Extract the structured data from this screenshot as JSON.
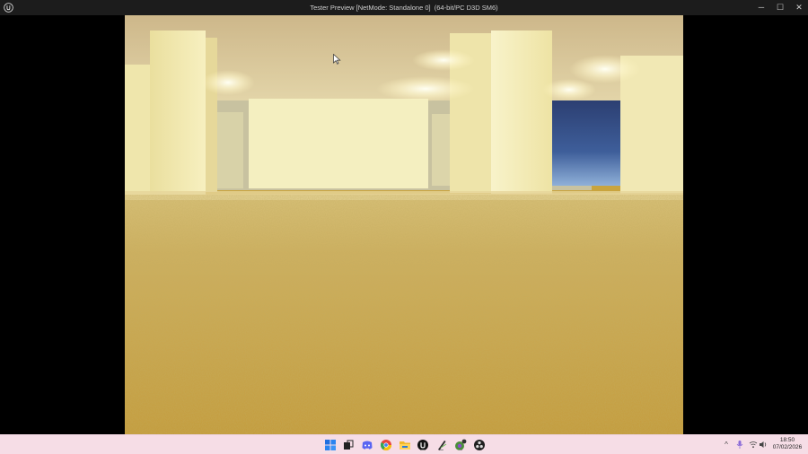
{
  "window": {
    "title": "Tester Preview [NetMode: Standalone 0]  (64-bit/PC D3D SM6)",
    "app_icon": "unreal-engine-icon",
    "controls": {
      "minimize": "─",
      "maximize": "☐",
      "close": "✕"
    }
  },
  "viewport": {
    "scene": "backrooms-style-yellow-room",
    "cursor_icon": "mouse-pointer-icon"
  },
  "taskbar": {
    "pinned": [
      {
        "name": "start-icon",
        "color": "#1f6fe0"
      },
      {
        "name": "taskview-icon",
        "color": "#222222"
      },
      {
        "name": "discord-icon",
        "color": "#5865f2"
      },
      {
        "name": "chrome-icon",
        "color": "#e8453c"
      },
      {
        "name": "file-explorer-icon",
        "color": "#f2b82a"
      },
      {
        "name": "unreal-engine-icon",
        "color": "#111111"
      },
      {
        "name": "pen-tool-icon",
        "color": "#2a2a2a"
      },
      {
        "name": "github-desktop-icon",
        "color": "#4b8f3a"
      },
      {
        "name": "obs-icon",
        "color": "#202020"
      }
    ],
    "tray": {
      "chevron": "^",
      "mic": "🎙",
      "network": "⌔",
      "volume": "🔊"
    },
    "clock": {
      "time": "18:50",
      "date": "07/02/2026"
    }
  },
  "colors": {
    "titlebar": "#1c1c1c",
    "taskbar": "#f6dde6",
    "ceiling": "#d9c89a",
    "wall": "#f3ecb7",
    "carpet": "#c9a43e"
  }
}
